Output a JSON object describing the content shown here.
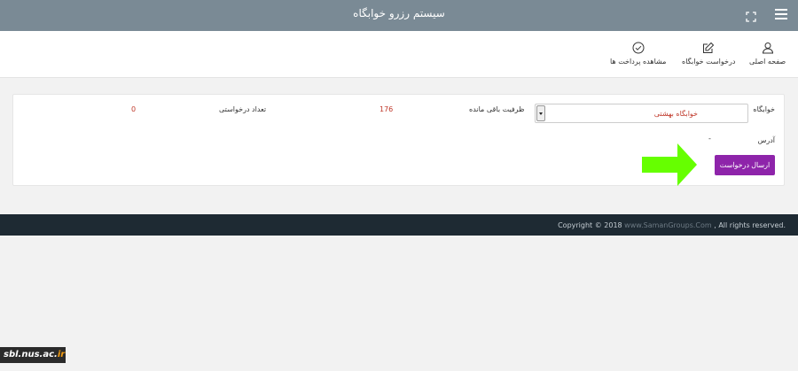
{
  "header": {
    "title": "سیستم رزرو خوابگاه"
  },
  "nav": {
    "items": [
      {
        "label": "صفحه اصلی",
        "icon": "user-icon"
      },
      {
        "label": "درخواست خوابگاه",
        "icon": "edit-icon"
      },
      {
        "label": "مشاهده پرداخت ها",
        "icon": "check-circle-icon"
      }
    ]
  },
  "form": {
    "dorm_label": "خوابگاه",
    "dorm_selected": "خوابگاه بهشتی",
    "capacity_label": "ظرفیت باقی مانده",
    "capacity_value": "176",
    "requests_label": "تعداد درخواستی",
    "requests_value": "0",
    "address_label": "آدرس",
    "address_value": "-",
    "submit_label": "ارسال درخواست"
  },
  "footer": {
    "prefix": "Copyright © 2018 ",
    "site": "www.SamanGroups.Com",
    "suffix": " , All rights reserved."
  },
  "watermark": {
    "name": "sbl.nus.ac.",
    "tld": "ir"
  },
  "colors": {
    "header_bg": "#7a8a95",
    "accent_purple": "#8e24aa",
    "value_red": "#c0392b",
    "footer_bg": "#1e2a33",
    "arrow_green": "#66ff00"
  }
}
